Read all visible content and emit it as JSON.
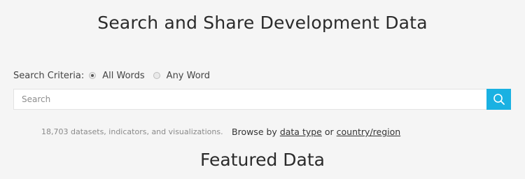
{
  "header": {
    "title": "Search and Share Development Data"
  },
  "search_criteria": {
    "label": "Search Criteria:",
    "options": [
      {
        "label": "All Words",
        "selected": true
      },
      {
        "label": "Any Word",
        "selected": false
      }
    ]
  },
  "search": {
    "placeholder": "Search",
    "value": "",
    "button_color": "#1ab1e2",
    "button_icon": "search-icon"
  },
  "stats": {
    "text": "18,703 datasets, indicators, and visualizations."
  },
  "browse": {
    "prefix": "Browse by",
    "link_data_type": "data type",
    "separator": "or",
    "link_country_region": "country/region"
  },
  "featured": {
    "title": "Featured Data"
  }
}
